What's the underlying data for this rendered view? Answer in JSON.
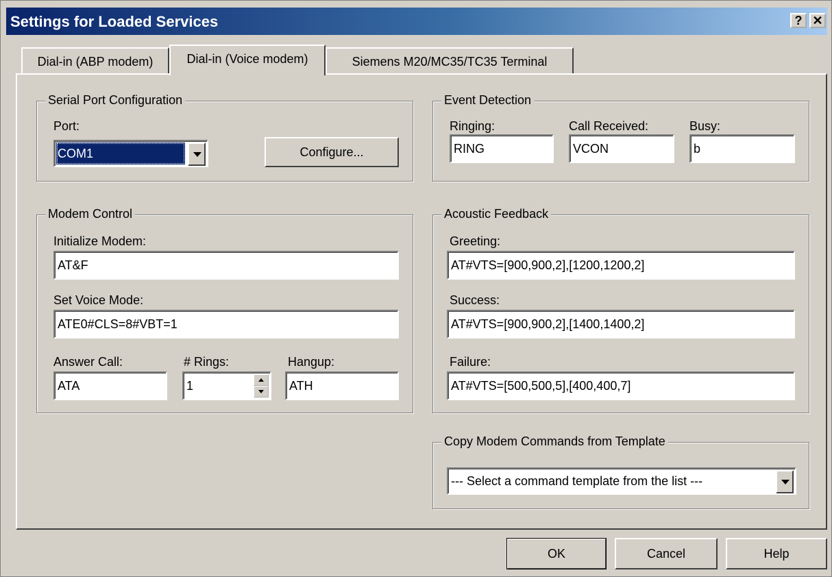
{
  "window": {
    "title": "Settings for Loaded Services",
    "help_glyph": "?",
    "close_glyph": "✕"
  },
  "tabs": [
    {
      "label": "Dial-in (ABP modem)"
    },
    {
      "label": "Dial-in (Voice modem)",
      "active": true
    },
    {
      "label": "Siemens M20/MC35/TC35 Terminal"
    }
  ],
  "serial": {
    "group_label": "Serial Port Configuration",
    "port_label": "Port:",
    "port_value": "COM1",
    "configure_label": "Configure..."
  },
  "event": {
    "group_label": "Event Detection",
    "ringing_label": "Ringing:",
    "ringing_value": "RING",
    "call_received_label": "Call Received:",
    "call_received_value": "VCON",
    "busy_label": "Busy:",
    "busy_value": "b"
  },
  "modem": {
    "group_label": "Modem Control",
    "init_label": "Initialize Modem:",
    "init_value": "AT&F",
    "voice_label": "Set Voice Mode:",
    "voice_value": "ATE0#CLS=8#VBT=1",
    "answer_label": "Answer Call:",
    "answer_value": "ATA",
    "rings_label": "# Rings:",
    "rings_value": "1",
    "hangup_label": "Hangup:",
    "hangup_value": "ATH"
  },
  "acoustic": {
    "group_label": "Acoustic Feedback",
    "greeting_label": "Greeting:",
    "greeting_value": "AT#VTS=[900,900,2],[1200,1200,2]",
    "success_label": "Success:",
    "success_value": "AT#VTS=[900,900,2],[1400,1400,2]",
    "failure_label": "Failure:",
    "failure_value": "AT#VTS=[500,500,5],[400,400,7]"
  },
  "template": {
    "group_label": "Copy Modem Commands from Template",
    "placeholder": "--- Select a command template from the list ---"
  },
  "buttons": {
    "ok": "OK",
    "cancel": "Cancel",
    "help": "Help"
  },
  "colors": {
    "title_start": "#0a246a",
    "title_end": "#a6caf0",
    "face": "#d4d0c8",
    "selection": "#0a246a"
  }
}
